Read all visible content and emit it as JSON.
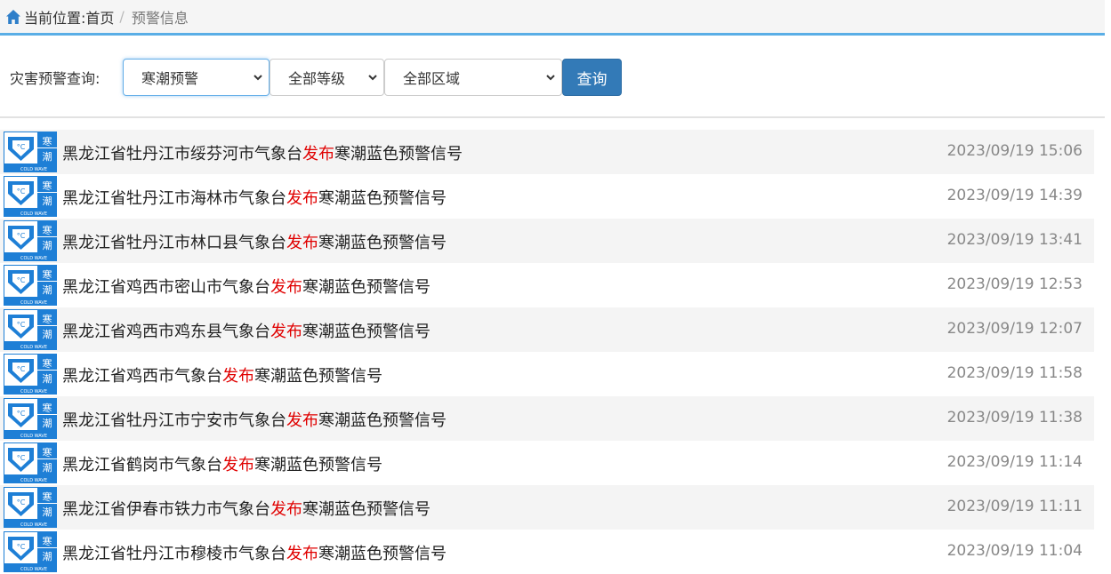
{
  "breadcrumb": {
    "prefix": "当前位置:",
    "home": "首页",
    "separator": "/",
    "current": "预警信息"
  },
  "query": {
    "label": "灾害预警查询:",
    "type_select": "寒潮预警",
    "level_select": "全部等级",
    "region_select": "全部区域",
    "button": "查询"
  },
  "badge": {
    "icon": "cold-wave-blue-icon",
    "char1": "寒",
    "char2": "潮",
    "caption": "COLD WAVE",
    "color": "#1e7fd6"
  },
  "alerts": [
    {
      "pre": "黑龙江省牡丹江市绥芬河市气象台",
      "verb": "发布",
      "post": "寒潮蓝色预警信号",
      "time": "2023/09/19 15:06"
    },
    {
      "pre": "黑龙江省牡丹江市海林市气象台",
      "verb": "发布",
      "post": "寒潮蓝色预警信号",
      "time": "2023/09/19 14:39"
    },
    {
      "pre": "黑龙江省牡丹江市林口县气象台",
      "verb": "发布",
      "post": "寒潮蓝色预警信号",
      "time": "2023/09/19 13:41"
    },
    {
      "pre": "黑龙江省鸡西市密山市气象台",
      "verb": "发布",
      "post": "寒潮蓝色预警信号",
      "time": "2023/09/19 12:53"
    },
    {
      "pre": "黑龙江省鸡西市鸡东县气象台",
      "verb": "发布",
      "post": "寒潮蓝色预警信号",
      "time": "2023/09/19 12:07"
    },
    {
      "pre": "黑龙江省鸡西市气象台",
      "verb": "发布",
      "post": "寒潮蓝色预警信号",
      "time": "2023/09/19 11:58"
    },
    {
      "pre": "黑龙江省牡丹江市宁安市气象台",
      "verb": "发布",
      "post": "寒潮蓝色预警信号",
      "time": "2023/09/19 11:38"
    },
    {
      "pre": "黑龙江省鹤岗市气象台",
      "verb": "发布",
      "post": "寒潮蓝色预警信号",
      "time": "2023/09/19 11:14"
    },
    {
      "pre": "黑龙江省伊春市铁力市气象台",
      "verb": "发布",
      "post": "寒潮蓝色预警信号",
      "time": "2023/09/19 11:11"
    },
    {
      "pre": "黑龙江省牡丹江市穆棱市气象台",
      "verb": "发布",
      "post": "寒潮蓝色预警信号",
      "time": "2023/09/19 11:04"
    }
  ]
}
